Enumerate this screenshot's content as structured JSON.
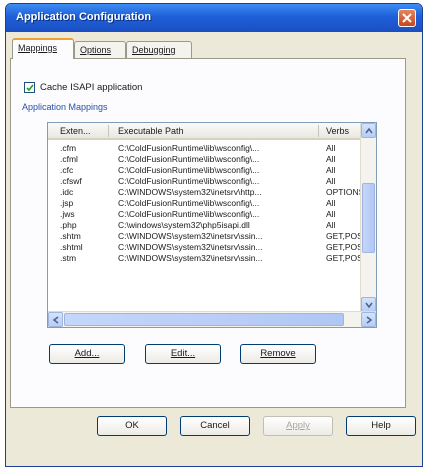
{
  "window": {
    "title": "Application Configuration"
  },
  "tabs": [
    {
      "label": "Mappings",
      "active": true
    },
    {
      "label": "Options",
      "active": false
    },
    {
      "label": "Debugging",
      "active": false
    }
  ],
  "cache_checkbox": {
    "label": "Cache ISAPI application",
    "checked": true
  },
  "group_label": "Application Mappings",
  "table": {
    "columns": [
      "Exten...",
      "Executable Path",
      "Verbs"
    ],
    "rows": [
      {
        "ext": ".cfm",
        "path": "C:\\ColdFusionRuntime\\lib\\wsconfig\\...",
        "verbs": "All"
      },
      {
        "ext": ".cfml",
        "path": "C:\\ColdFusionRuntime\\lib\\wsconfig\\...",
        "verbs": "All"
      },
      {
        "ext": ".cfc",
        "path": "C:\\ColdFusionRuntime\\lib\\wsconfig\\...",
        "verbs": "All"
      },
      {
        "ext": ".cfswf",
        "path": "C:\\ColdFusionRuntime\\lib\\wsconfig\\...",
        "verbs": "All"
      },
      {
        "ext": ".idc",
        "path": "C:\\WINDOWS\\system32\\inetsrv\\http...",
        "verbs": "OPTIONS"
      },
      {
        "ext": ".jsp",
        "path": "C:\\ColdFusionRuntime\\lib\\wsconfig\\...",
        "verbs": "All"
      },
      {
        "ext": ".jws",
        "path": "C:\\ColdFusionRuntime\\lib\\wsconfig\\...",
        "verbs": "All"
      },
      {
        "ext": ".php",
        "path": "C:\\windows\\system32\\php5isapi.dll",
        "verbs": "All"
      },
      {
        "ext": ".shtm",
        "path": "C:\\WINDOWS\\system32\\inetsrv\\ssin...",
        "verbs": "GET,POS"
      },
      {
        "ext": ".shtml",
        "path": "C:\\WINDOWS\\system32\\inetsrv\\ssin...",
        "verbs": "GET,POS"
      },
      {
        "ext": ".stm",
        "path": "C:\\WINDOWS\\system32\\inetsrv\\ssin...",
        "verbs": "GET,POS"
      }
    ]
  },
  "buttons": {
    "add": "Add...",
    "edit": "Edit...",
    "remove": "Remove",
    "ok": "OK",
    "cancel": "Cancel",
    "apply": "Apply",
    "help": "Help"
  },
  "colors": {
    "title_bar": "#1f5fd8",
    "close_button": "#c8451f",
    "dialog_bg": "#ece9d8",
    "active_tab_accent": "#f0a030"
  },
  "icons": [
    "close-icon",
    "checkmark-icon",
    "scroll-up-icon",
    "scroll-down-icon",
    "scroll-left-icon",
    "scroll-right-icon"
  ]
}
